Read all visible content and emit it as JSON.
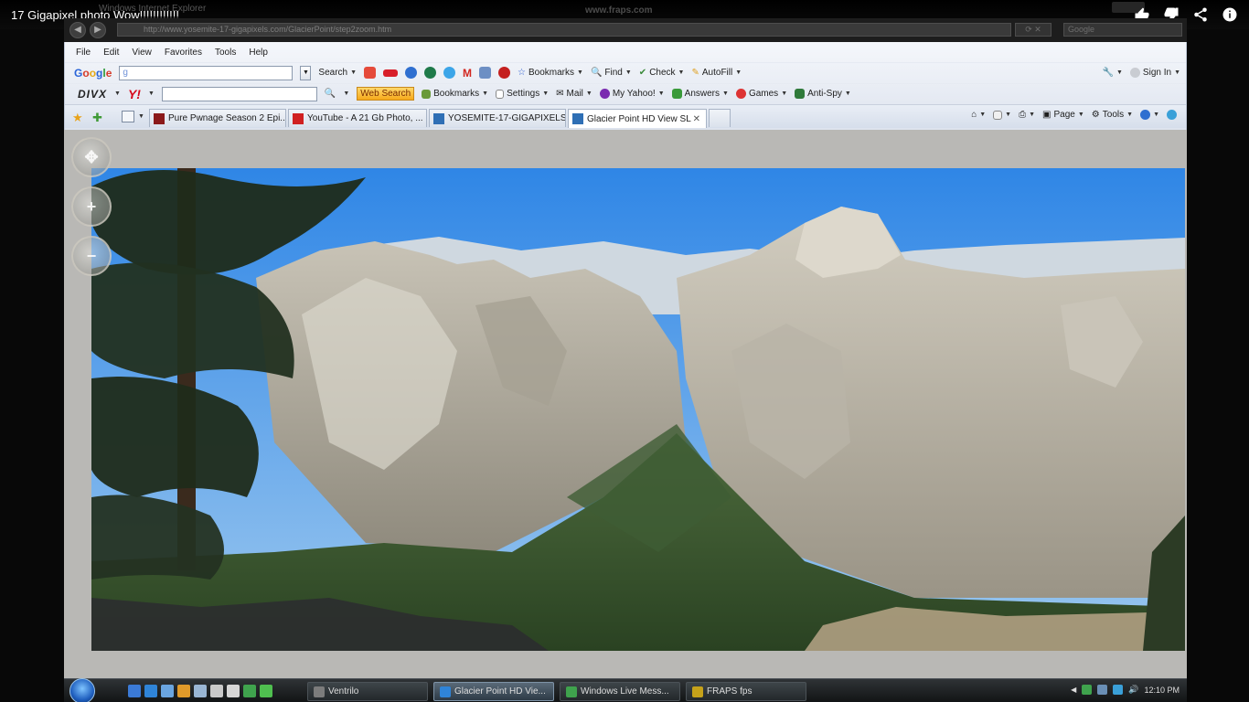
{
  "video": {
    "title": "17 Gigapixel photo Wow!!!!!!!!!!!!",
    "icons": [
      "thumbs-up-icon",
      "thumbs-down-icon",
      "share-icon",
      "info-icon"
    ]
  },
  "window": {
    "title": "Windows Internet Explorer",
    "capture_watermark": "www.fraps.com"
  },
  "address_bar": {
    "url": "http://www.yosemite-17-gigapixels.com/GlacierPoint/step2zoom.htm",
    "search_placeholder": "Google"
  },
  "menu": {
    "items": [
      "File",
      "Edit",
      "View",
      "Favorites",
      "Tools",
      "Help"
    ]
  },
  "google_toolbar": {
    "search_value": "g",
    "search_label": "Search",
    "bookmarks": "Bookmarks",
    "find": "Find",
    "check": "Check",
    "autofill": "AutoFill",
    "sign_in": "Sign In"
  },
  "divx_toolbar": {
    "brand": "DIVX",
    "yahoo": "Y!",
    "web_search": "Web Search",
    "bookmarks": "Bookmarks",
    "settings": "Settings",
    "mail": "Mail",
    "my_yahoo": "My Yahoo!",
    "answers": "Answers",
    "games": "Games",
    "anti_spy": "Anti-Spy"
  },
  "tabs": [
    {
      "label": "Pure Pwnage Season 2 Epi...",
      "color": "#8b1a1a"
    },
    {
      "label": "YouTube - A 21 Gb Photo, ...",
      "color": "#d02020"
    },
    {
      "label": "YOSEMITE-17-GIGAPIXELS",
      "color": "#2f6fb5"
    },
    {
      "label": "Glacier Point HD View SL",
      "color": "#2f6fb5",
      "active": true
    }
  ],
  "command_bar": {
    "page": "Page",
    "tools": "Tools"
  },
  "taskbar": {
    "tasks": [
      {
        "label": "Ventrilo",
        "color": "#7c7c7c"
      },
      {
        "label": "Glacier Point HD Vie...",
        "color": "#2f84d8",
        "active": true
      },
      {
        "label": "Windows Live Mess...",
        "color": "#3fa34d"
      },
      {
        "label": "FRAPS fps",
        "color": "#c6a21a"
      }
    ],
    "clock": "12:10 PM"
  },
  "colors": {
    "browser_bg": "#e9eef6",
    "sky": "#4f97e0",
    "page_bg": "#b9b8b5"
  }
}
